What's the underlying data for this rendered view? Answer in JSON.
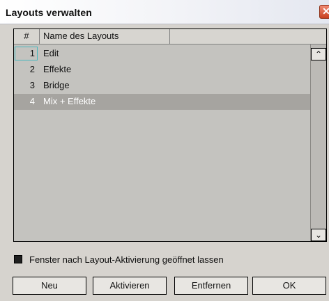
{
  "window": {
    "title": "Layouts verwalten",
    "close_glyph": "✕"
  },
  "table": {
    "columns": [
      "#",
      "Name des Layouts",
      ""
    ],
    "rows": [
      {
        "num": "1",
        "name": "Edit"
      },
      {
        "num": "2",
        "name": "Effekte"
      },
      {
        "num": "3",
        "name": "Bridge"
      },
      {
        "num": "4",
        "name": "Mix + Effekte"
      }
    ],
    "selected_row_index": 3,
    "focused_row_index": 0
  },
  "scrollbar": {
    "up_glyph": "⌃",
    "down_glyph": "⌄"
  },
  "option": {
    "label": "Fenster nach Layout-Aktivierung geöffnet lassen",
    "checked": false
  },
  "buttons": {
    "new": "Neu",
    "activate": "Aktivieren",
    "remove": "Entfernen",
    "ok": "OK"
  },
  "colors": {
    "dialog_bg": "#d6d3ce",
    "list_bg": "#c4c3bf",
    "selected_row": "#a6a4a0",
    "focus_outline": "#46b7bd",
    "close_button": "#d9533a"
  }
}
